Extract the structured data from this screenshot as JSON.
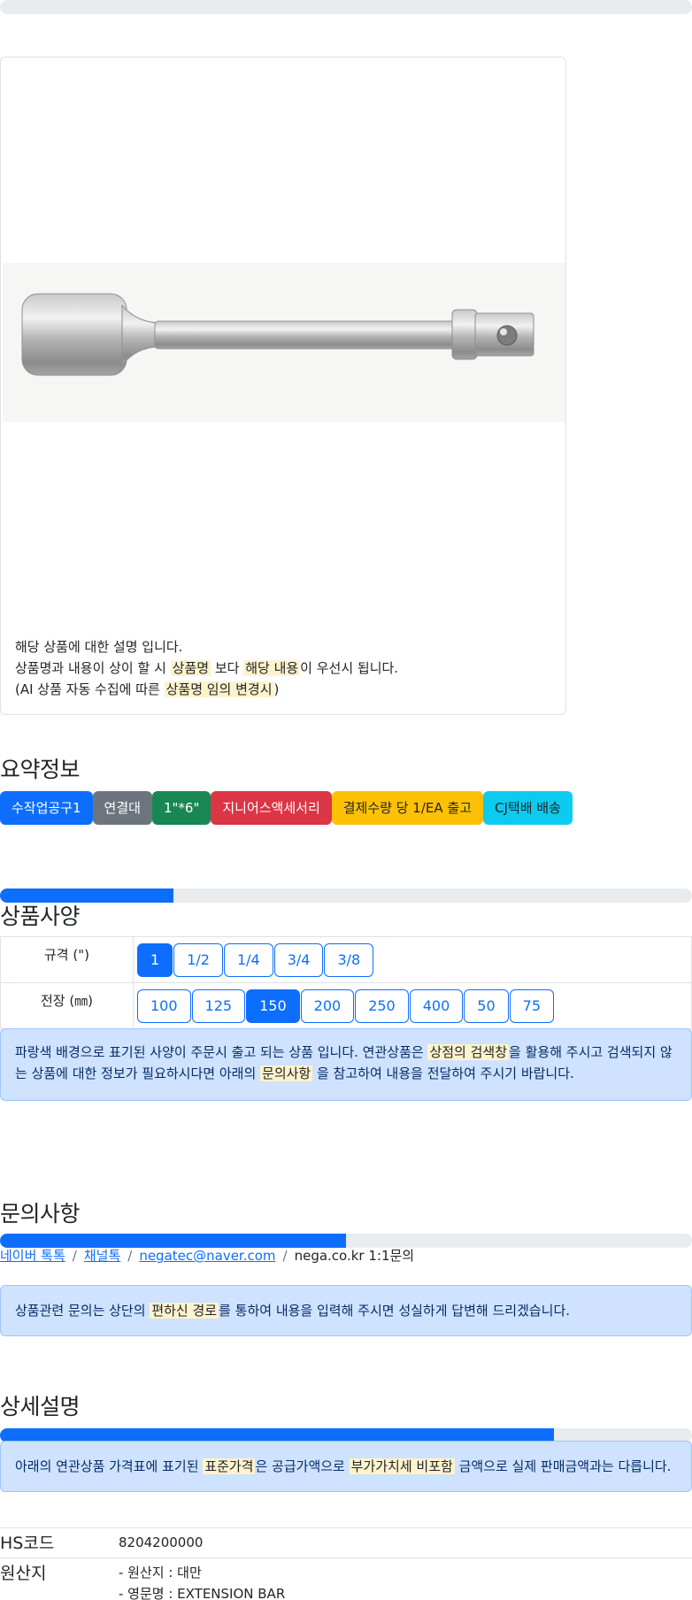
{
  "product": {
    "image_alt": "extension bar",
    "desc_line1": "해당 상품에 대한 설명 입니다.",
    "desc_line2_a": "상품명과 내용이 상이 할 시 ",
    "desc_line2_hl1": "상품명",
    "desc_line2_b": " 보다 ",
    "desc_line2_hl2": "해당 내용",
    "desc_line2_c": "이 우선시 됩니다.",
    "desc_line3_a": "(AI 상품 자동 수집에 따른 ",
    "desc_line3_hl": "상품명 임의 변경시",
    "desc_line3_b": ")"
  },
  "summary": {
    "title": "요약정보",
    "badges": [
      "수작업공구1",
      "연결대",
      "1\"*6\"",
      "지니어스액세서리",
      "결제수량 당 1/EA 출고",
      "CJ택배 배송"
    ]
  },
  "specs": {
    "title": "상품사양",
    "progress": 0.25,
    "rows": [
      {
        "label": "규격 (\")",
        "options": [
          "1",
          "1/2",
          "1/4",
          "3/4",
          "3/8"
        ],
        "selected": "1"
      },
      {
        "label": "전장 (㎜)",
        "options": [
          "100",
          "125",
          "150",
          "200",
          "250",
          "400",
          "50",
          "75"
        ],
        "selected": "150"
      }
    ],
    "notice_a": "파랑색 배경으로 표기된 사양이 주문시 출고 되는 상품 입니다. 연관상품은 ",
    "notice_hl1": "상점의 검색창",
    "notice_b": "을 활용해 주시고 검색되지 않는 상품에 대한 정보가 필요하시다면 아래의 ",
    "notice_hl2": "문의사항",
    "notice_c": " 을 참고하여 내용을 전달하여 주시기 바랍니다."
  },
  "inquiry": {
    "title": "문의사항",
    "progress": 0.5,
    "links": [
      "네이버 톡톡",
      "채널톡",
      "negatec@naver.com"
    ],
    "plain": "nega.co.kr 1:1문의",
    "separator": "/",
    "notice_a": "상품관련 문의는 상단의 ",
    "notice_hl": "편하신 경로",
    "notice_b": "를 통하여 내용을 입력해 주시면 성실하게 답변해 드리겠습니다."
  },
  "detail": {
    "title": "상세설명",
    "progress": 0.8,
    "notice_a": "아래의 연관상품 가격표에 표기된 ",
    "notice_hl1": "표준가격",
    "notice_b": "은 공급가액으로 ",
    "notice_hl2": "부가가치세 비포함",
    "notice_c": " 금액으로 실제 판매금액과는 다릅니다.",
    "hs_label": "HS코드",
    "hs_value": "8204200000",
    "origin_label": "원산지",
    "origin_line1": "- 원산지 : 대만",
    "origin_line2": "- 영문명 : EXTENSION BAR"
  },
  "colors": {
    "primary": "#0d6efd",
    "alert_bg": "#cfe2ff",
    "highlight": "#fff3cd"
  }
}
